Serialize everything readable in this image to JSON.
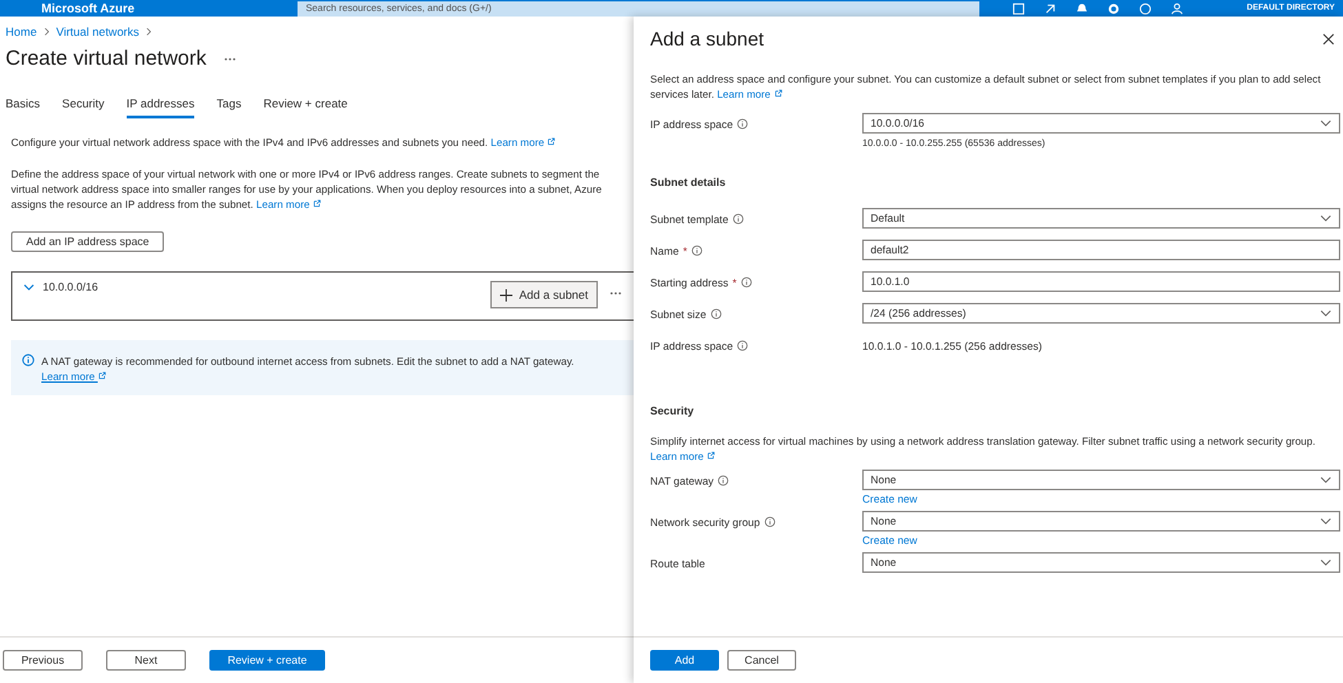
{
  "top_bar": {
    "brand": "Microsoft Azure",
    "search": {
      "placeholder": "Search resources, services, and docs (G+/)"
    },
    "directory": "DEFAULT DIRECTORY"
  },
  "breadcrumb": [
    "Home",
    "Virtual networks"
  ],
  "title": "Create virtual network",
  "tabs": [
    {
      "label": "Basics",
      "selected": false
    },
    {
      "label": "Security",
      "selected": false
    },
    {
      "label": "IP addresses",
      "selected": true
    },
    {
      "label": "Tags",
      "selected": false
    },
    {
      "label": "Review + create",
      "selected": false
    }
  ],
  "intro": {
    "text": "Configure your virtual network address space with the IPv4 and IPv6 addresses and subnets you need.",
    "link": "Learn more"
  },
  "description": {
    "text": "Define the address space of your virtual network with one or more IPv4 or IPv6 address ranges. Create subnets to segment the virtual network address space into smaller ranges for use by your applications. When you deploy resources into a subnet, Azure assigns the resource an IP address from the subnet.",
    "link": "Learn more"
  },
  "add_space_button": "Add an IP address space",
  "address_space": {
    "label": "10.0.0.0/16",
    "expanded": true,
    "add_subnet_button": "Add a subnet"
  },
  "info": {
    "text": "A NAT gateway is recommended for outbound internet access from subnets. Edit the subnet to add a NAT gateway.",
    "link": "Learn more"
  },
  "footer": [
    "Previous",
    "Next",
    "Review + create"
  ],
  "panel": {
    "title": "Add a subnet",
    "description": {
      "text": "Select an address space and configure your subnet. You can customize a default subnet or select from subnet templates if you plan to add select services later.",
      "link": "Learn more"
    },
    "sections": [
      {
        "fields": [
          {
            "label": "IP address space",
            "info": true,
            "kind": "select",
            "value": "10.0.0.0/16",
            "note": "10.0.0.0 - 10.0.255.255 (65536 addresses)"
          }
        ]
      },
      {
        "heading": "Subnet details",
        "fields": [
          {
            "label": "Subnet template",
            "info": true,
            "kind": "select",
            "value": "Default"
          },
          {
            "label": "Name",
            "required_mark": "*",
            "info": true,
            "kind": "input",
            "value": "default2"
          },
          {
            "label": "Starting address",
            "required_mark": "*",
            "info": true,
            "kind": "input",
            "value": "10.0.1.0"
          },
          {
            "label": "Subnet size",
            "info": true,
            "kind": "select",
            "value": "/24 (256 addresses)"
          },
          {
            "label": "IP address space",
            "info": true,
            "kind": "static",
            "value": "10.0.1.0 - 10.0.1.255 (256 addresses)"
          }
        ]
      },
      {
        "heading": "Security",
        "text": "Simplify internet access for virtual machines by using a network address translation gateway. Filter subnet traffic using a network security group.",
        "link": "Learn more",
        "fields": [
          {
            "label": "NAT gateway",
            "info": true,
            "kind": "select",
            "value": "None",
            "action": "Create new"
          },
          {
            "label": "Network security group",
            "info": true,
            "kind": "select",
            "value": "None",
            "action": "Create new"
          },
          {
            "label": "Route table",
            "info": false,
            "kind": "select",
            "value": "None"
          }
        ]
      }
    ],
    "buttons": [
      "Add",
      "Cancel"
    ]
  }
}
